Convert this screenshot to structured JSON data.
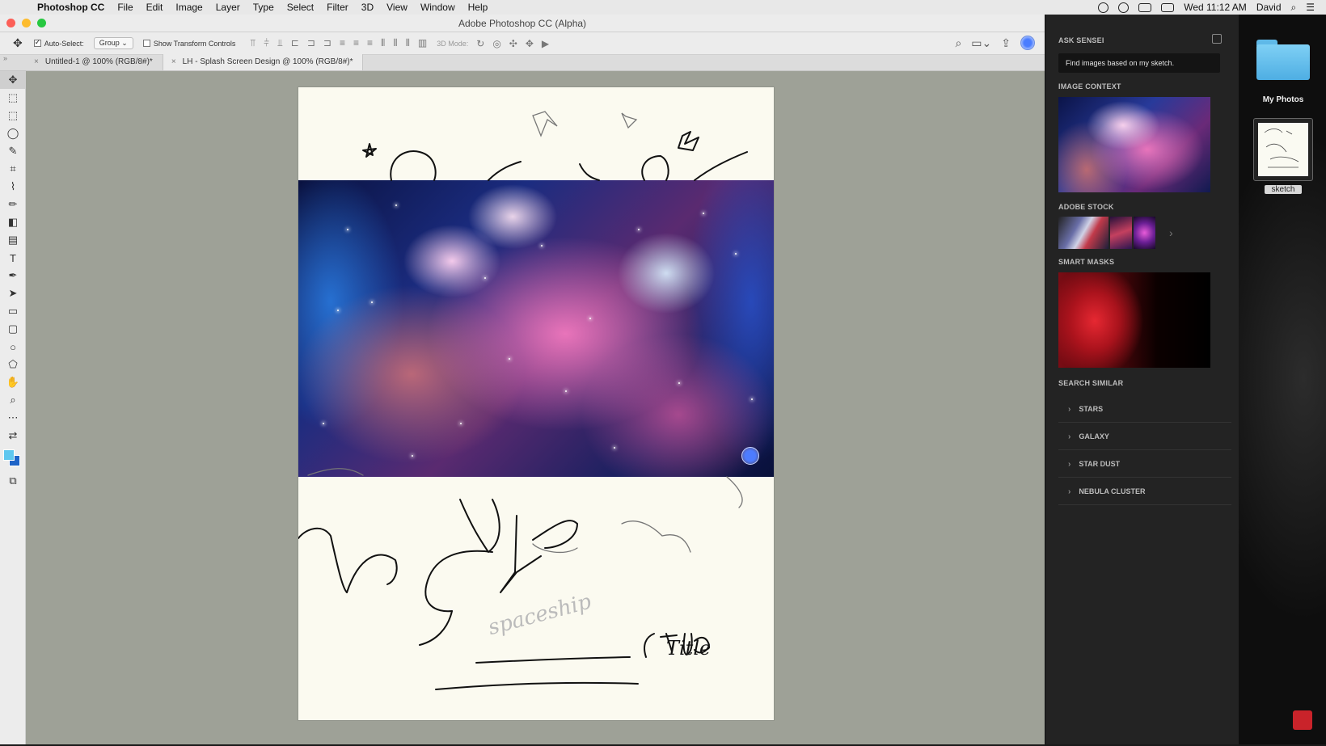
{
  "menubar": {
    "app_name": "Photoshop CC",
    "menus": [
      "File",
      "Edit",
      "Image",
      "Layer",
      "Type",
      "Select",
      "Filter",
      "3D",
      "View",
      "Window",
      "Help"
    ],
    "datetime": "Wed 11:12 AM",
    "user": "David"
  },
  "window": {
    "title": "Adobe Photoshop CC (Alpha)"
  },
  "options_bar": {
    "auto_select_label": "Auto-Select:",
    "auto_select_value": "Group",
    "show_transform_label": "Show Transform Controls",
    "mode_3d_label": "3D Mode:"
  },
  "tabs": [
    {
      "label": "Untitled-1 @ 100% (RGB/8#)*"
    },
    {
      "label": "LH - Splash Screen Design @ 100% (RGB/8#)*"
    }
  ],
  "colors": {
    "foreground": "#5ec7ef",
    "background": "#1d63c7"
  },
  "canvas": {
    "sketch_text": [
      "spaceship",
      "Title"
    ]
  },
  "sensei": {
    "ask_heading": "ASK SENSEI",
    "query": "Find images based on my sketch.",
    "image_context_heading": "IMAGE CONTEXT",
    "adobe_stock_heading": "ADOBE STOCK",
    "smart_masks_heading": "SMART MASKS",
    "search_similar_heading": "SEARCH SIMILAR",
    "search_similar": [
      "STARS",
      "GALAXY",
      "STAR DUST",
      "NEBULA CLUSTER"
    ]
  },
  "desktop": {
    "folder_label": "My Photos",
    "file_label": "sketch"
  }
}
